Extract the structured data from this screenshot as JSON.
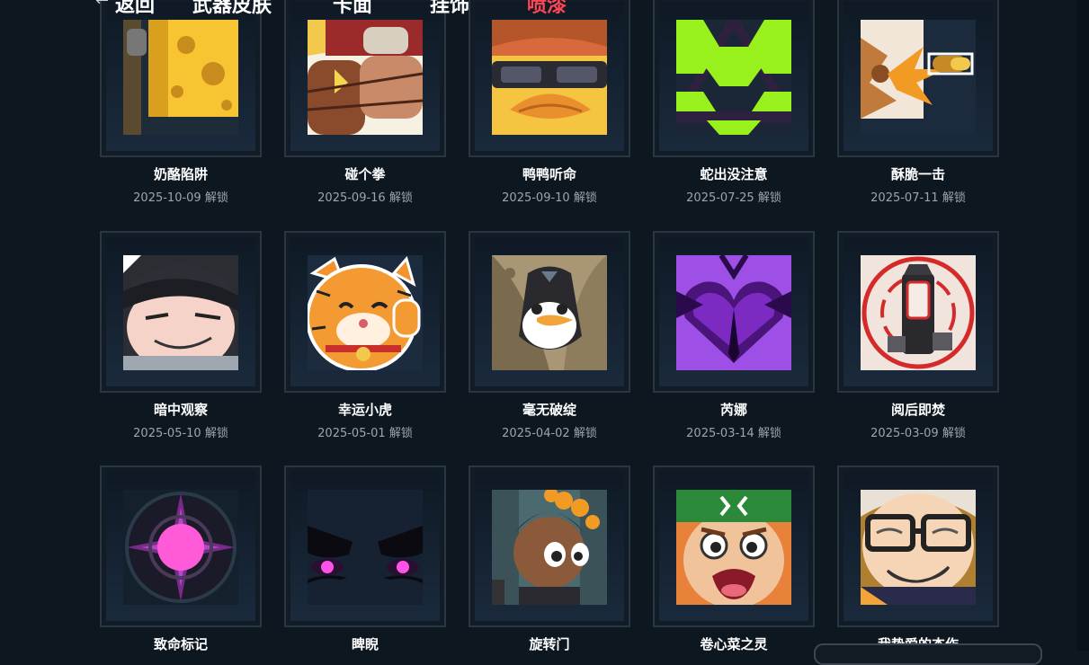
{
  "nav": {
    "back_arrow": "←",
    "back_label": "返回",
    "tabs": [
      "武器皮肤",
      "卡面",
      "挂饰",
      "喷漆"
    ],
    "active_tab": "喷漆",
    "active_color": "#ff4655"
  },
  "sprays": [
    {
      "name": "奶酪陷阱",
      "date": "2025-10-09 解锁",
      "icon": "cheese-trap-icon"
    },
    {
      "name": "碰个拳",
      "date": "2025-09-16 解锁",
      "icon": "fist-bump-icon"
    },
    {
      "name": "鸭鸭听命",
      "date": "2025-09-10 解锁",
      "icon": "duck-sunglasses-icon"
    },
    {
      "name": "蛇出没注意",
      "date": "2025-07-25 解锁",
      "icon": "green-hexagon-icon"
    },
    {
      "name": "酥脆一击",
      "date": "2025-07-11 解锁",
      "icon": "crispy-bullet-icon"
    },
    {
      "name": "暗中观察",
      "date": "2025-05-10 解锁",
      "icon": "smug-face-icon"
    },
    {
      "name": "幸运小虎",
      "date": "2025-05-01 解锁",
      "icon": "lucky-tiger-icon"
    },
    {
      "name": "毫无破绽",
      "date": "2025-04-02 解锁",
      "icon": "penguin-icon"
    },
    {
      "name": "芮娜",
      "date": "2025-03-14 解锁",
      "icon": "purple-heart-icon"
    },
    {
      "name": "阅后即焚",
      "date": "2025-03-09 解锁",
      "icon": "target-pillar-icon"
    },
    {
      "name": "致命标记",
      "date": "",
      "icon": "pink-star-icon"
    },
    {
      "name": "睥睨",
      "date": "",
      "icon": "glowing-eyes-icon"
    },
    {
      "name": "旋转门",
      "date": "",
      "icon": "agent-portrait-icon"
    },
    {
      "name": "卷心菜之灵",
      "date": "",
      "icon": "shouting-face-icon"
    },
    {
      "name": "我挚爱的杰作",
      "date": "",
      "icon": "glasses-grin-icon"
    }
  ],
  "colors": {
    "background": "#0d1720",
    "card_border": "#2a3642",
    "date_text": "#9aa5ae"
  }
}
